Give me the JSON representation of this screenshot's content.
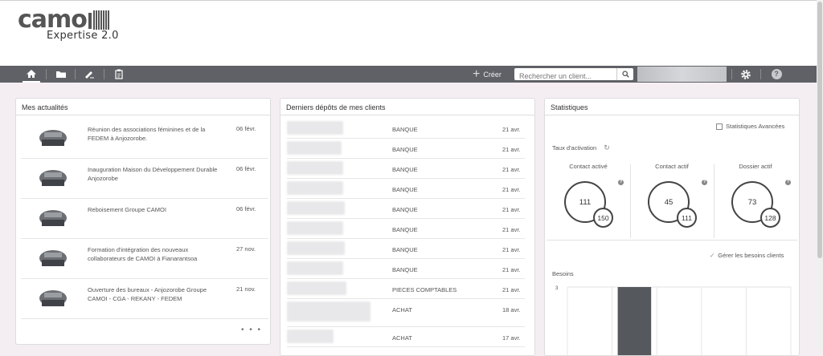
{
  "header": {
    "logo_main": "camo",
    "logo_sub": "Expertise 2.0"
  },
  "nav": {
    "icons": [
      "home-icon",
      "folder-icon",
      "edit-icon",
      "clipboard-icon"
    ],
    "create_label": "Créer",
    "search_placeholder": "Rechercher un client...",
    "settings_icon": "gear-icon",
    "help_icon": "question-icon"
  },
  "actualites": {
    "title": "Mes actualités",
    "items": [
      {
        "text": "Réunion des associations féminines et de la FEDEM à Anjozorobe.",
        "date": "06 févr."
      },
      {
        "text": "Inauguration Maison du Développement Durable Anjozorobe",
        "date": "06 févr."
      },
      {
        "text": "Reboisement Groupe CAMOI",
        "date": "06 févr."
      },
      {
        "text": "Formation d'intégration des nouveaux collaborateurs de CAMOI à Fianarantsoa",
        "date": "27 nov."
      },
      {
        "text": "Ouverture des bureaux - Anjozorobe Groupe CAMOI - CGA - REKANY - FEDEM",
        "date": "21 nov."
      }
    ],
    "more": "• • •"
  },
  "depots": {
    "title": "Derniers dépôts de mes clients",
    "rows": [
      {
        "type": "BANQUE",
        "date": "21 avr."
      },
      {
        "type": "BANQUE",
        "date": "21 avr."
      },
      {
        "type": "BANQUE",
        "date": "21 avr."
      },
      {
        "type": "BANQUE",
        "date": "21 avr."
      },
      {
        "type": "BANQUE",
        "date": "21 avr."
      },
      {
        "type": "BANQUE",
        "date": "21 avr."
      },
      {
        "type": "BANQUE",
        "date": "21 avr."
      },
      {
        "type": "BANQUE",
        "date": "21 avr."
      },
      {
        "type": "PIECES COMPTABLES",
        "date": "21 avr."
      },
      {
        "type": "ACHAT",
        "date": "18 avr."
      },
      {
        "type": "ACHAT",
        "date": "17 avr."
      }
    ]
  },
  "stats": {
    "title": "Statistiques",
    "advanced_link": "Statistiques Avancées",
    "taux_label": "Taux d'activation",
    "columns": [
      {
        "label": "Contact activé",
        "value": "111",
        "total": "150"
      },
      {
        "label": "Contact actif",
        "value": "45",
        "total": "111"
      },
      {
        "label": "Dossier actif",
        "value": "73",
        "total": "128"
      }
    ],
    "manage_link": "Gérer les besoins clients",
    "besoins_label": "Besoins",
    "chart_data": {
      "type": "bar",
      "ylim": [
        0,
        3
      ],
      "y_tick_labels": [
        "3"
      ],
      "values": [
        0,
        3,
        0,
        0,
        0
      ],
      "colors": {
        "bar": "#55585d"
      }
    }
  }
}
